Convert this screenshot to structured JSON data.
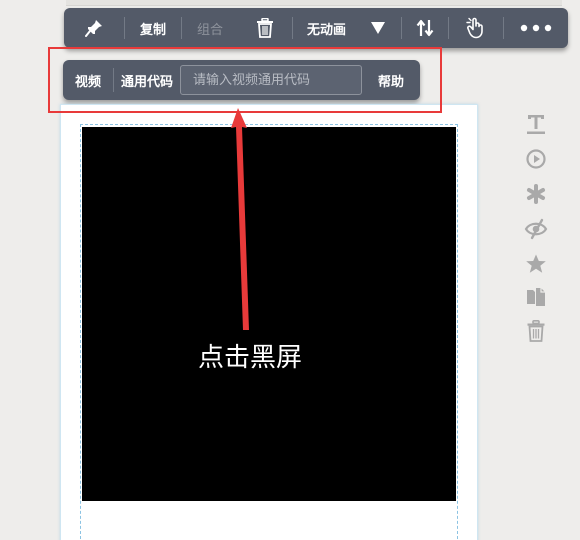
{
  "toolbar": {
    "copy_label": "复制",
    "group_label": "组合",
    "animation_label": "无动画"
  },
  "video_bar": {
    "video_label": "视频",
    "code_label": "通用代码",
    "code_placeholder": "请输入视频通用代码",
    "code_value": "",
    "help_label": "帮助"
  },
  "canvas": {
    "hint_text": "点击黑屏"
  },
  "side_tools": [
    "text-icon",
    "play-icon",
    "asterisk-icon",
    "eye-slash-icon",
    "star-icon",
    "copy-icon",
    "trash-icon"
  ],
  "colors": {
    "toolbar_bg": "#535a68",
    "highlight": "#e83a3a",
    "side_icon": "#a9a9a9",
    "video_bg": "#000000"
  }
}
